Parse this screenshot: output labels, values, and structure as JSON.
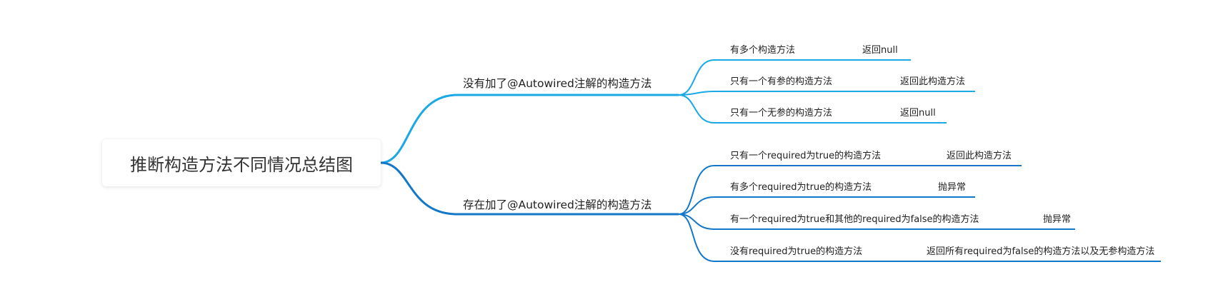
{
  "root": {
    "title": "推断构造方法不同情况总结图"
  },
  "branches": [
    {
      "label": "没有加了@Autowired注解的构造方法",
      "color": "#1aa8e6",
      "children": [
        {
          "label": "有多个构造方法",
          "result": "返回null"
        },
        {
          "label": "只有一个有参的构造方法",
          "result": "返回此构造方法"
        },
        {
          "label": "只有一个无参的构造方法",
          "result": "返回null"
        }
      ]
    },
    {
      "label": "存在加了@Autowired注解的构造方法",
      "color": "#1477c8",
      "children": [
        {
          "label": "只有一个required为true的构造方法",
          "result": "返回此构造方法"
        },
        {
          "label": "有多个required为true的构造方法",
          "result": "抛异常"
        },
        {
          "label": "有一个required为true和其他的required为false的构造方法",
          "result": "抛异常"
        },
        {
          "label": "没有required为true的构造方法",
          "result": "返回所有required为false的构造方法以及无参构造方法"
        }
      ]
    }
  ]
}
